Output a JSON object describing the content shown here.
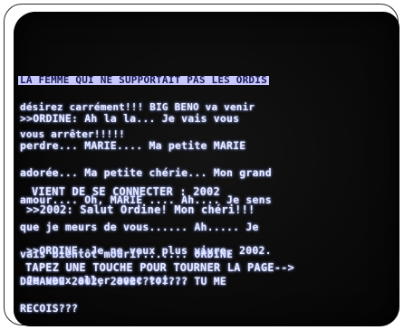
{
  "screen": {
    "banner": "LA FEMME QUI NE SUPPORTAIT PAS LES ORDIS",
    "scroll_lines": [
      "désirez carrément!!! BIG BENO va venir",
      "vous arrêter!!!!!"
    ],
    "ordine_block": [
      ">>ORDINE: Ah la la... Je vais vous",
      "perdre... MARIE.... Ma petite MARIE",
      "adorée... Ma petite chérie... Mon grand",
      "amour.... Oh, MARIE .... Ah.... Je sens",
      "que je meurs de vous...... Ah..... Je",
      "vais bientôt mourir....... ORDINE",
      "DEMANDE 2002, 2002???????? TU ME",
      "RECOIS???"
    ],
    "connect_line": "VIENT DE SE CONNECTER : 2002",
    "reply_line": ">>2002: Salut Ordine! Mon chéri!!!",
    "ordine_reply": [
      ">>ORDINE: Je ne veux plus vivre, 2002.",
      "Je veux aller avec toi..."
    ],
    "prompt": "TAPEZ UNE TOUCHE POUR TOURNER LA PAGE-->"
  },
  "colors": {
    "screen_bg": "#0b0b0b",
    "text": "#e9ecff",
    "banner_bg": "#c8c8ff"
  }
}
